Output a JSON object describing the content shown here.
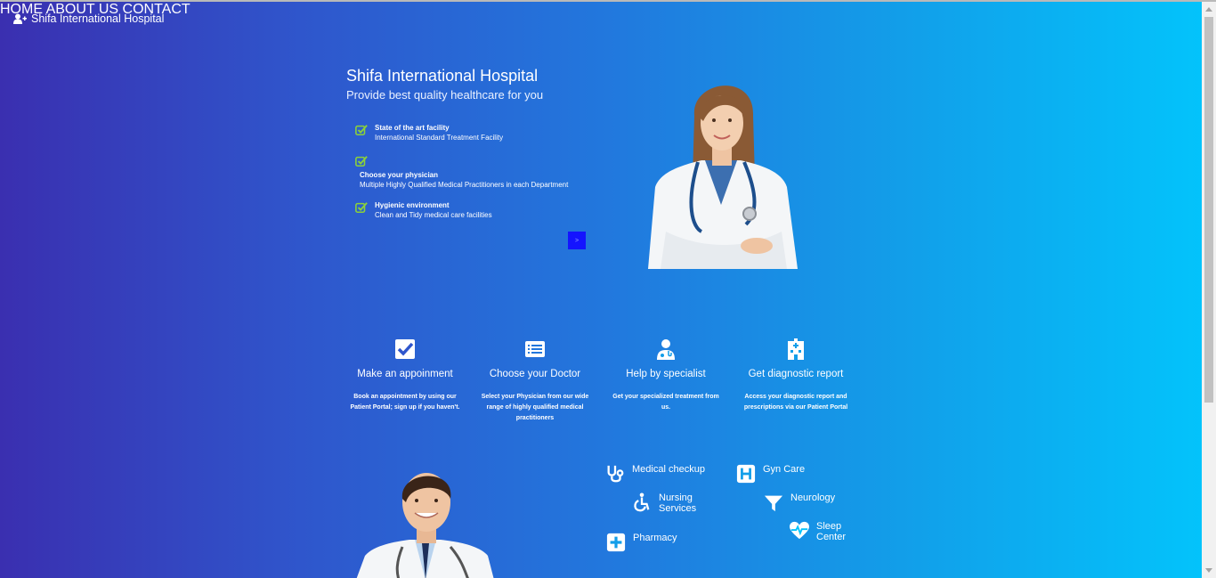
{
  "brand": {
    "name": "Shifa International Hospital",
    "icon": "user-plus-icon"
  },
  "nav": {
    "items": [
      {
        "label": "HOME"
      },
      {
        "label": "ABOUT US"
      },
      {
        "label": "CONTACT"
      }
    ]
  },
  "hero": {
    "title": "Shifa International Hospital",
    "subtitle": "Provide best quality healthcare for you",
    "features": [
      {
        "title": "State of the art facility",
        "description": "International Standard Treatment Facility",
        "icon": "check-square-icon"
      },
      {
        "title": "Choose your physician",
        "description": "Multiple Highly Qualified Medical Practitioners in each Department",
        "icon": "check-square-icon"
      },
      {
        "title": "Hygienic environment",
        "description": "Clean and Tidy medical care facilities",
        "icon": "check-square-icon"
      }
    ],
    "next_label": ">"
  },
  "services": [
    {
      "title": "Make an appoinment",
      "description": "Book an appointment by using our Patient Portal; sign up if you haven't.",
      "icon": "check-box-icon"
    },
    {
      "title": "Choose your Doctor",
      "description": "Select your Physician from our wide range of highly qualified medical practitioners",
      "icon": "list-card-icon"
    },
    {
      "title": "Help by specialist",
      "description": "Get your specialized treatment from us.",
      "icon": "doctor-icon"
    },
    {
      "title": "Get diagnostic report",
      "description": "Access your diagnostic report and prescriptions via our Patient Portal",
      "icon": "hospital-building-icon"
    }
  ],
  "departments": [
    {
      "label": "Medical checkup",
      "icon": "stethoscope-icon"
    },
    {
      "label": "Gyn Care",
      "icon": "hospital-h-icon"
    },
    {
      "label": "Nursing Services",
      "icon": "wheelchair-icon"
    },
    {
      "label": "Neurology",
      "icon": "filter-icon"
    },
    {
      "label": "Pharmacy",
      "icon": "plus-square-icon"
    },
    {
      "label": "Sleep Center",
      "icon": "heartbeat-icon"
    }
  ],
  "colors": {
    "gradient_start": "#3a2fb0",
    "gradient_end": "#03c3fb",
    "check_green": "#8bd13a",
    "next_button": "#1414ff"
  }
}
